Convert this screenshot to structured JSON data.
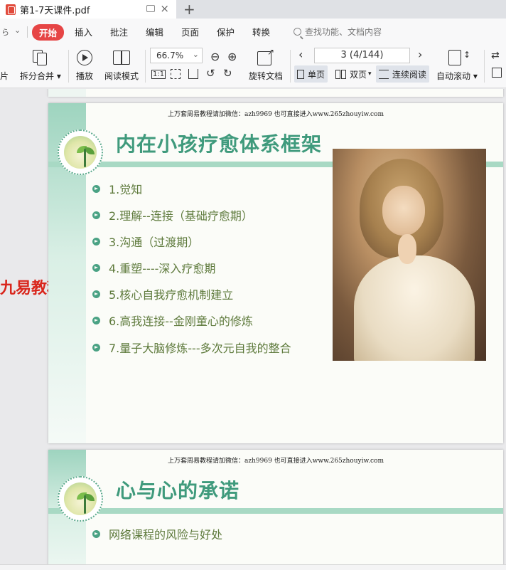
{
  "tab": {
    "title": "第1-7天课件.pdf",
    "close": "×",
    "new_tab": "+"
  },
  "menu": {
    "items": [
      "开始",
      "插入",
      "批注",
      "编辑",
      "页面",
      "保护",
      "转换"
    ],
    "lead_text": "ら",
    "search_placeholder": "查找功能、文档内容"
  },
  "toolbar": {
    "leading_label": "片",
    "split_merge": "拆分合并",
    "play": "播放",
    "read_mode": "阅读模式",
    "zoom": "66.7%",
    "rotate_doc": "旋转文档",
    "page_indicator": "3 (4/144)",
    "single_page": "单页",
    "double_page": "双页",
    "continuous": "连续阅读",
    "auto_scroll": "自动滚动",
    "fit_icon_text": "1:1"
  },
  "watermark_side": "九易教程",
  "pages": [
    {
      "header": "上万套周易教程请加微信：azh9969  也可直接进入www.265zhouyiw.com",
      "title": "内在小孩疗愈体系框架",
      "bullets": [
        "1.觉知",
        "2.理解--连接（基础疗愈期）",
        "3.沟通（过渡期）",
        "4.重塑----深入疗愈期",
        "5.核心自我疗愈机制建立",
        "6.高我连接--金刚童心的修炼",
        "7.量子大脑修炼---多次元自我的整合"
      ]
    },
    {
      "header": "上万套周易教程请加微信：azh9969  也可直接进入www.265zhouyiw.com",
      "title": "心与心的承诺",
      "bullets": [
        "网络课程的风险与好处"
      ]
    }
  ],
  "colors": {
    "accent": "#e64545",
    "slide_title": "#3f9a7c",
    "band": "#a8d9c4",
    "bullet_text": "#5e7a3c"
  }
}
